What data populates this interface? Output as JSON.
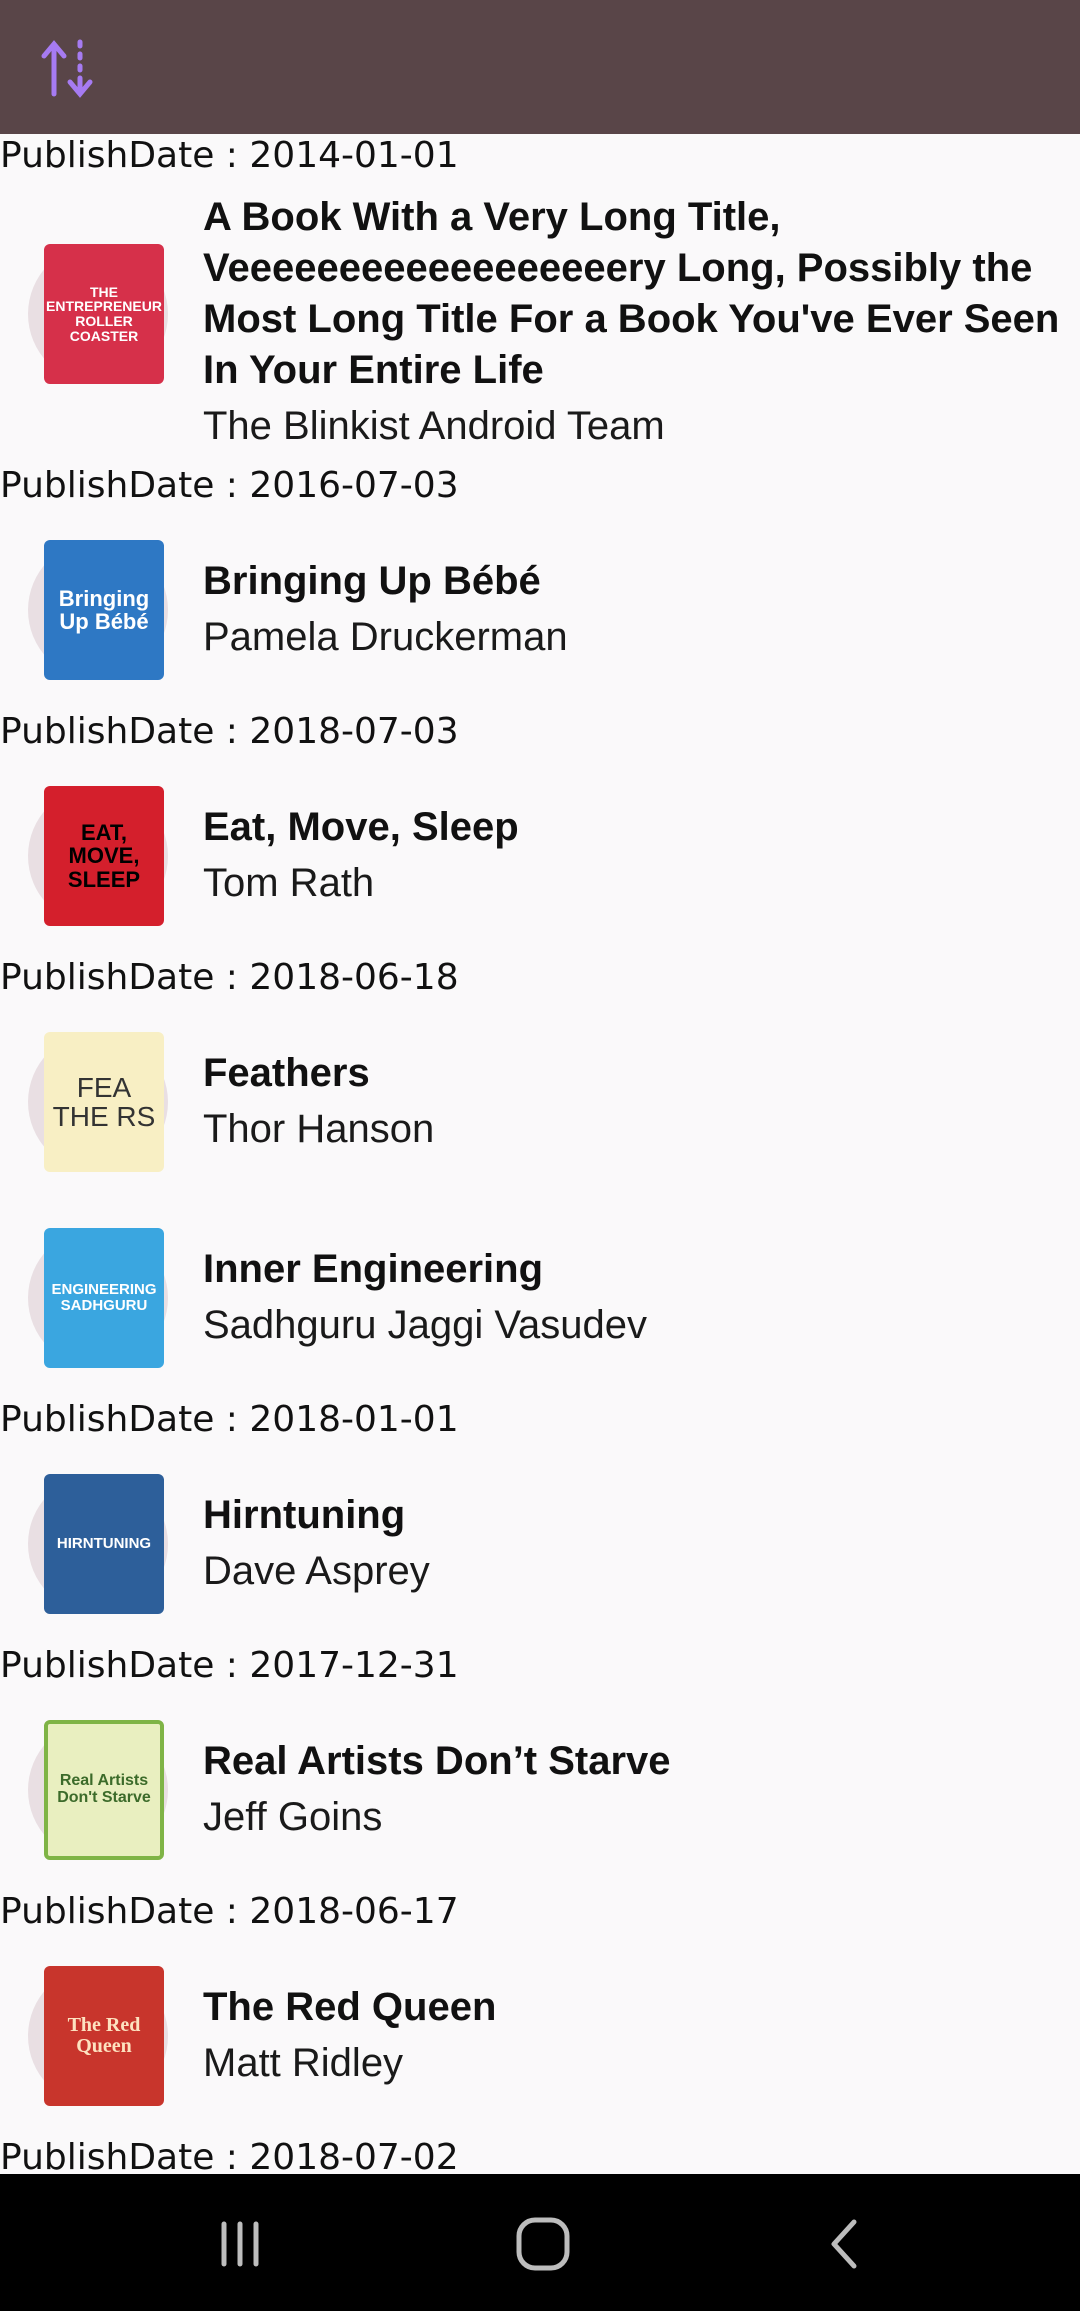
{
  "toolbar": {
    "sort_icon": "sort-up-down-icon",
    "accent": "#594548",
    "icon_color": "#a67bf2"
  },
  "dates": [
    "PublishDate : 2014-01-01",
    "PublishDate : 2016-07-03",
    "PublishDate : 2018-07-03",
    "PublishDate : 2018-06-18",
    "PublishDate : 2018-01-01",
    "PublishDate : 2017-12-31",
    "PublishDate : 2018-06-17",
    "PublishDate : 2018-07-02"
  ],
  "books": [
    {
      "title": "A Book With a Very Long Title, Veeeeeeeeeeeeeeeeeery Long, Possibly the Most Long Title For a Book You've Ever Seen In Your Entire Life",
      "author": "The Blinkist Android Team",
      "cover_text": "THE ENTREPRENEUR ROLLER COASTER",
      "cover_color": "#d6304a"
    },
    {
      "title": "Bringing Up Bébé",
      "author": "Pamela Druckerman",
      "cover_text": "Bringing Up Bébé",
      "cover_color": "#2e78c4"
    },
    {
      "title": "Eat, Move, Sleep",
      "author": "Tom Rath",
      "cover_text": "EAT, MOVE, SLEEP",
      "cover_color": "#d41f2c"
    },
    {
      "title": "Feathers",
      "author": "Thor Hanson",
      "cover_text": "FEA THE RS",
      "cover_color": "#f8efc4"
    },
    {
      "title": "Inner Engineering",
      "author": "Sadhguru Jaggi Vasudev",
      "cover_text": "ENGINEERING SADHGURU",
      "cover_color": "#3aa6e0"
    },
    {
      "title": "Hirntuning",
      "author": "Dave Asprey",
      "cover_text": "HIRNTUNING",
      "cover_color": "#2d5f9a"
    },
    {
      "title": "Real Artists Don’t Starve",
      "author": "Jeff Goins",
      "cover_text": "Real Artists Don't Starve",
      "cover_color": "#e9efc0"
    },
    {
      "title": "The Red Queen",
      "author": "Matt Ridley",
      "cover_text": "The Red Queen",
      "cover_color": "#c8352c"
    }
  ],
  "navbar": {
    "recents_icon": "recents-icon",
    "home_icon": "home-icon",
    "back_icon": "back-icon"
  }
}
